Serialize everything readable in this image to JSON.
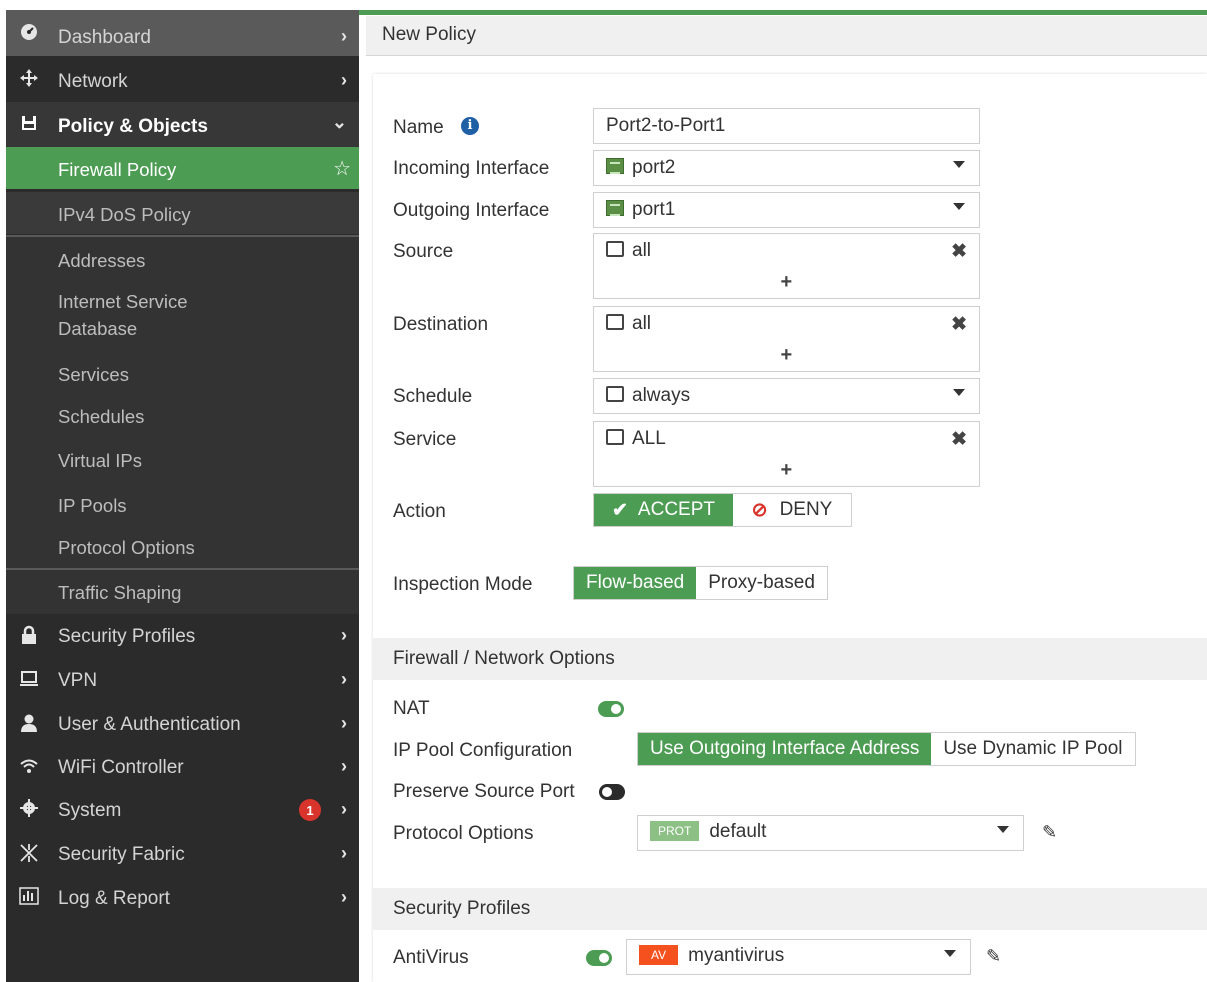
{
  "sidebar": {
    "dashboard": "Dashboard",
    "network": "Network",
    "policy_objects": "Policy & Objects",
    "sub": {
      "firewall_policy": "Firewall Policy",
      "ipv4_dos": "IPv4 DoS Policy",
      "addresses": "Addresses",
      "isdb_line1": "Internet Service",
      "isdb_line2": "Database",
      "services": "Services",
      "schedules": "Schedules",
      "virtual_ips": "Virtual IPs",
      "ip_pools": "IP Pools",
      "protocol_options": "Protocol Options",
      "traffic_shaping": "Traffic Shaping"
    },
    "security_profiles": "Security Profiles",
    "vpn": "VPN",
    "user_auth": "User & Authentication",
    "wifi": "WiFi Controller",
    "system": "System",
    "system_badge": "1",
    "security_fabric": "Security Fabric",
    "log_report": "Log & Report"
  },
  "header": {
    "title": "New Policy"
  },
  "form": {
    "name_label": "Name",
    "name_value": "Port2-to-Port1",
    "incoming_label": "Incoming Interface",
    "incoming_value": "port2",
    "outgoing_label": "Outgoing Interface",
    "outgoing_value": "port1",
    "source_label": "Source",
    "source_value": "all",
    "destination_label": "Destination",
    "destination_value": "all",
    "schedule_label": "Schedule",
    "schedule_value": "always",
    "service_label": "Service",
    "service_value": "ALL",
    "action_label": "Action",
    "accept_label": "ACCEPT",
    "deny_label": "DENY",
    "inspection_label": "Inspection Mode",
    "flow_label": "Flow-based",
    "proxy_label": "Proxy-based"
  },
  "firewall_options": {
    "section_title": "Firewall / Network Options",
    "nat_label": "NAT",
    "nat_enabled": true,
    "ippool_label": "IP Pool Configuration",
    "ippool_outgoing": "Use Outgoing Interface Address",
    "ippool_dynamic": "Use Dynamic IP Pool",
    "preserve_label": "Preserve Source Port",
    "preserve_enabled": false,
    "protocol_label": "Protocol Options",
    "protocol_pill": "PROT",
    "protocol_value": "default"
  },
  "security_profiles": {
    "section_title": "Security Profiles",
    "antivirus_label": "AntiVirus",
    "antivirus_enabled": true,
    "av_pill": "AV",
    "av_value": "myantivirus"
  },
  "colors": {
    "accent_green": "#4d9c54",
    "sidebar_bg": "#2b2b2b",
    "badge_red": "#d9342b",
    "av_orange": "#f4511e",
    "prot_green": "#8cc084"
  },
  "icons": {
    "dashboard": "dashboard-icon",
    "network": "network-move-icon",
    "policy": "policy-icon",
    "security": "lock-icon",
    "vpn": "laptop-icon",
    "user": "user-icon",
    "wifi": "wifi-icon",
    "system": "gear-icon",
    "fabric": "fabric-icon",
    "log": "bar-chart-icon"
  }
}
